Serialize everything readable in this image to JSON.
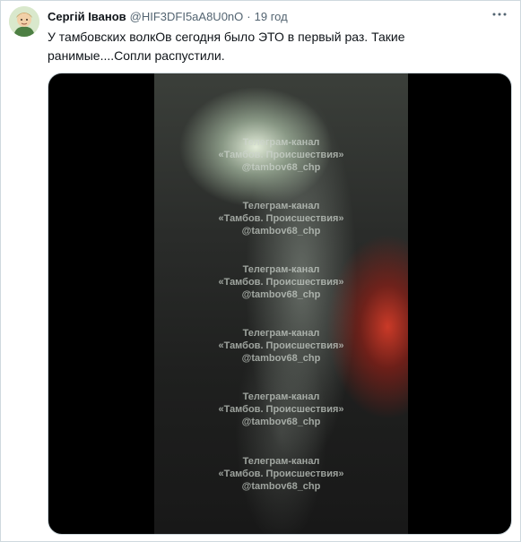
{
  "tweet": {
    "author_name": "Сергій Іванов",
    "handle": "@HIF3DFI5aA8U0nO",
    "separator": "·",
    "time": "19 год",
    "text_lines": [
      "У тамбовских волкОв сегодня было ЭТО в первый раз. Такие",
      "ранимые....Сопли распустили."
    ]
  },
  "video": {
    "watermarks": [
      {
        "line1": "Телеграм-канал",
        "line2": "«Тамбов. Происшествия»",
        "line3": "@tambov68_chp"
      },
      {
        "line1": "Телеграм-канал",
        "line2": "«Тамбов. Происшествия»",
        "line3": "@tambov68_chp"
      },
      {
        "line1": "Телеграм-канал",
        "line2": "«Тамбов. Происшествия»",
        "line3": "@tambov68_chp"
      },
      {
        "line1": "Телеграм-канал",
        "line2": "«Тамбов. Происшествия»",
        "line3": "@tambov68_chp"
      },
      {
        "line1": "Телеграм-канал",
        "line2": "«Тамбов. Происшествия»",
        "line3": "@tambov68_chp"
      },
      {
        "line1": "Телеграм-канал",
        "line2": "«Тамбов. Происшествия»",
        "line3": "@tambov68_chp"
      }
    ]
  },
  "icons": {
    "avatar": "avatar",
    "more": "more-horizontal-icon"
  },
  "colors": {
    "text": "#0f1419",
    "secondary": "#536471",
    "border": "#cfd9de",
    "media_background": "#000000"
  }
}
